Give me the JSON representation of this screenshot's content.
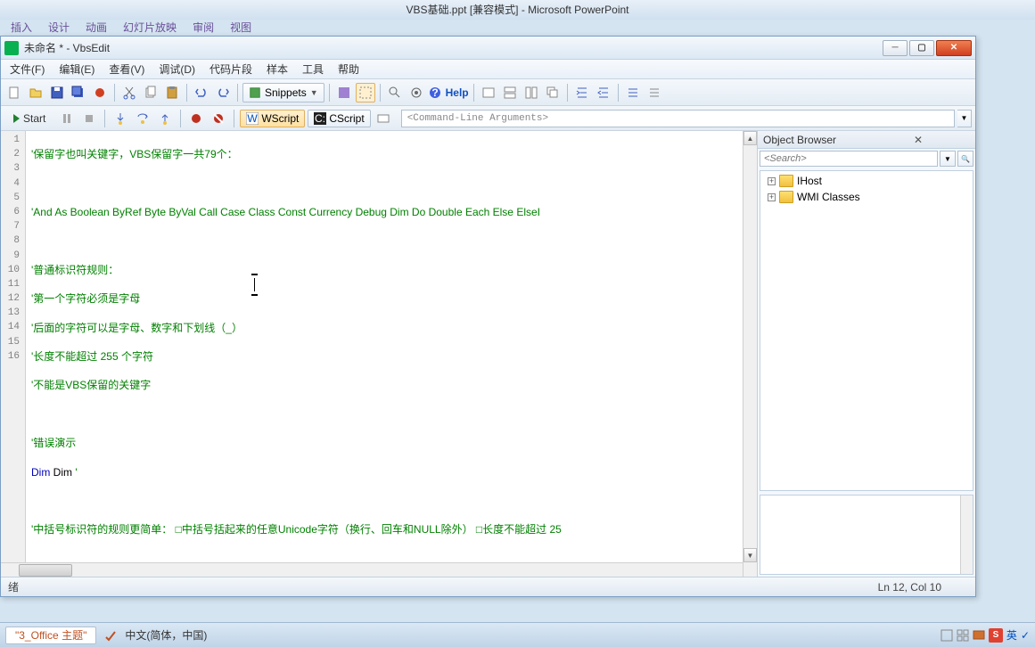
{
  "powerpoint": {
    "title": "VBS基础.ppt [兼容模式] - Microsoft PowerPoint",
    "ribbon": [
      "插入",
      "设计",
      "动画",
      "幻灯片放映",
      "审阅",
      "视图"
    ]
  },
  "vbsedit": {
    "title": "未命名 * - VbsEdit",
    "menu": [
      "文件(F)",
      "编辑(E)",
      "查看(V)",
      "调试(D)",
      "代码片段",
      "样本",
      "工具",
      "帮助"
    ],
    "snippets": "Snippets",
    "help": "Help",
    "start": "Start",
    "wscript": "WScript",
    "cscript": "CScript",
    "cmdline": "<Command-Line Arguments>",
    "code": {
      "l1": "'保留字也叫关键字，VBS保留字一共79个：",
      "l3": "'And As Boolean ByRef Byte ByVal Call Case Class Const Currency Debug Dim Do Double Each Else ElseI",
      "l5": "'普通标识符规则：",
      "l6": "'第一个字符必须是字母",
      "l7": "'后面的字符可以是字母、数字和下划线（_）",
      "l8": "'长度不能超过 255 个字符",
      "l9": "'不能是VBS保留的关键字",
      "l11": "'错误演示",
      "l12a": "Dim",
      "l12b": " Dim ",
      "l12c": "'",
      "l14": "'中括号标识符的规则更简单： □中括号括起来的任意Unicode字符（换行、回车和NULL除外） □长度不能超过 25"
    },
    "ob": {
      "title": "Object Browser",
      "search": "<Search>",
      "ihost": "IHost",
      "wmi": "WMI Classes"
    },
    "status_left": "绪",
    "status_right": "Ln 12, Col 10"
  },
  "taskbar": {
    "theme": "\"3_Office 主题\"",
    "lang": "中文(简体，中国)",
    "ime": "英"
  }
}
